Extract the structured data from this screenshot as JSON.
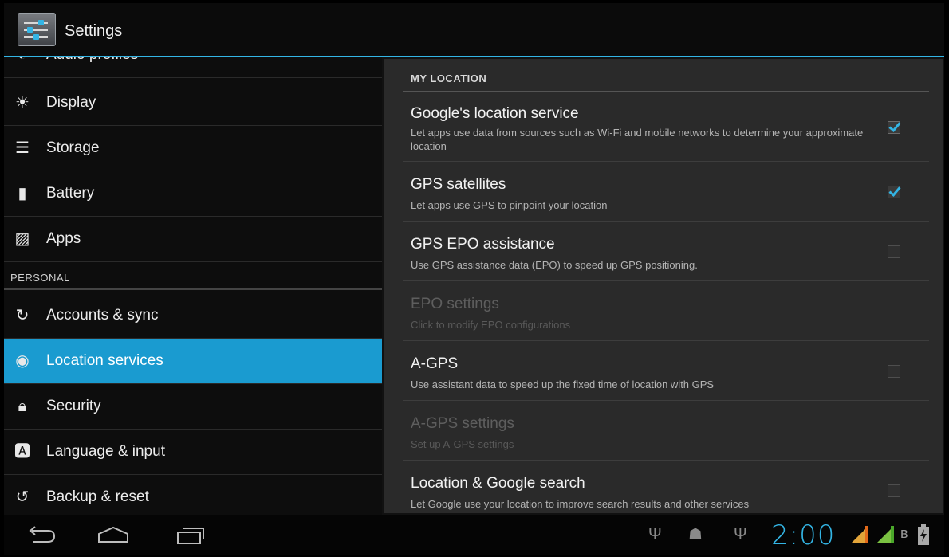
{
  "actionbar": {
    "title": "Settings",
    "app_icon": "settings-icon"
  },
  "left": {
    "items_top": [
      {
        "label": "Audio profiles",
        "icon": "audio-profiles-icon"
      },
      {
        "label": "Display",
        "icon": "display-icon"
      },
      {
        "label": "Storage",
        "icon": "storage-icon"
      },
      {
        "label": "Battery",
        "icon": "battery-icon"
      },
      {
        "label": "Apps",
        "icon": "apps-icon"
      }
    ],
    "section_personal": "PERSONAL",
    "items_personal": [
      {
        "label": "Accounts & sync",
        "icon": "sync-icon"
      },
      {
        "label": "Location services",
        "icon": "location-icon",
        "selected": true
      },
      {
        "label": "Security",
        "icon": "lock-icon"
      },
      {
        "label": "Language & input",
        "icon": "language-icon"
      },
      {
        "label": "Backup & reset",
        "icon": "backup-icon"
      }
    ]
  },
  "right": {
    "header": "MY LOCATION",
    "items": [
      {
        "title": "Google's location service",
        "summary": "Let apps use data from sources such as Wi-Fi and mobile networks to determine your approximate location",
        "checked": true,
        "enabled": true
      },
      {
        "title": "GPS satellites",
        "summary": "Let apps use GPS to pinpoint your location",
        "checked": true,
        "enabled": true
      },
      {
        "title": "GPS EPO assistance",
        "summary": "Use GPS assistance data (EPO) to speed up GPS positioning.",
        "checked": false,
        "enabled": true
      },
      {
        "title": "EPO settings",
        "summary": "Click to modify EPO configurations",
        "enabled": false
      },
      {
        "title": "A-GPS",
        "summary": "Use assistant data to speed up the fixed time of location with GPS",
        "checked": false,
        "enabled": true
      },
      {
        "title": "A-GPS settings",
        "summary": "Set up A-GPS settings",
        "enabled": false
      },
      {
        "title": "Location & Google search",
        "summary": "Let Google use your location to improve search results and other services",
        "checked": false,
        "enabled": true
      }
    ]
  },
  "navbar": {
    "buttons": [
      "back-icon",
      "home-icon",
      "recent-apps-icon"
    ],
    "status_icons": [
      "usb-icon",
      "android-debug-icon",
      "usb-icon",
      "signal-icon",
      "signal-icon",
      "bluetooth-icon",
      "battery-charging-icon"
    ],
    "clock": "2:00"
  },
  "colors": {
    "accent": "#33b5e5",
    "selected_bg": "#1a9bd0"
  }
}
